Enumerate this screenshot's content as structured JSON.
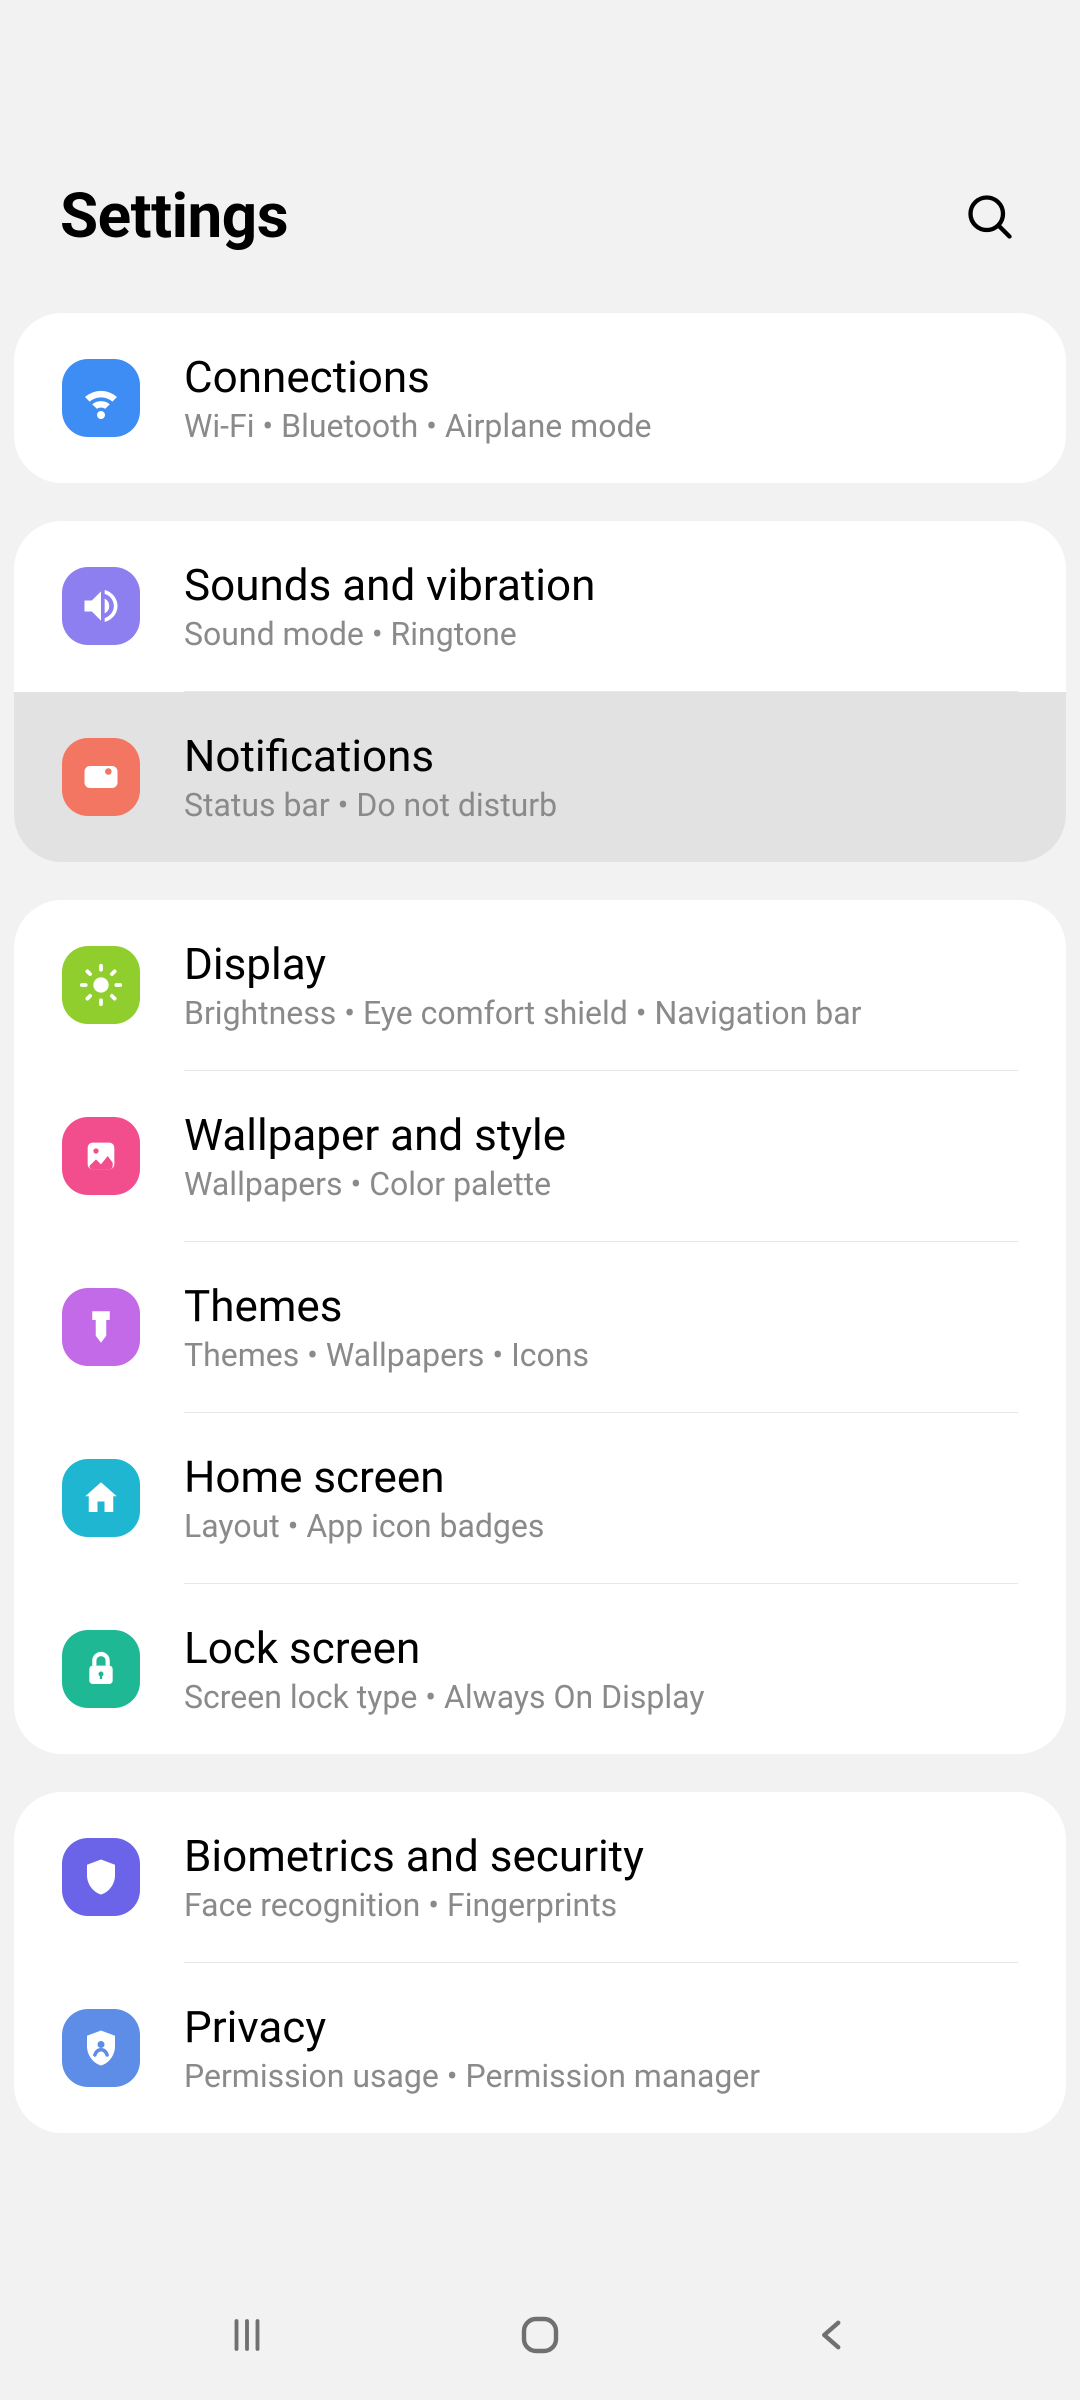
{
  "header": {
    "title": "Settings"
  },
  "groups": [
    {
      "items": [
        {
          "id": "connections",
          "title": "Connections",
          "subtitle": "Wi-Fi  •  Bluetooth  •  Airplane mode",
          "iconColor": "bg-blue-wifi",
          "highlighted": false
        }
      ]
    },
    {
      "items": [
        {
          "id": "sounds",
          "title": "Sounds and vibration",
          "subtitle": "Sound mode  •  Ringtone",
          "iconColor": "bg-purple-sound",
          "highlighted": false
        },
        {
          "id": "notifications",
          "title": "Notifications",
          "subtitle": "Status bar  •  Do not disturb",
          "iconColor": "bg-coral",
          "highlighted": true
        }
      ]
    },
    {
      "items": [
        {
          "id": "display",
          "title": "Display",
          "subtitle": "Brightness  •  Eye comfort shield  •  Navigation bar",
          "iconColor": "bg-green-display",
          "highlighted": false
        },
        {
          "id": "wallpaper",
          "title": "Wallpaper and style",
          "subtitle": "Wallpapers  •  Color palette",
          "iconColor": "bg-pink",
          "highlighted": false
        },
        {
          "id": "themes",
          "title": "Themes",
          "subtitle": "Themes  •  Wallpapers  •  Icons",
          "iconColor": "bg-purple-themes",
          "highlighted": false
        },
        {
          "id": "homescreen",
          "title": "Home screen",
          "subtitle": "Layout  •  App icon badges",
          "iconColor": "bg-cyan",
          "highlighted": false
        },
        {
          "id": "lockscreen",
          "title": "Lock screen",
          "subtitle": "Screen lock type  •  Always On Display",
          "iconColor": "bg-teal",
          "highlighted": false
        }
      ]
    },
    {
      "items": [
        {
          "id": "biometrics",
          "title": "Biometrics and security",
          "subtitle": "Face recognition  •  Fingerprints",
          "iconColor": "bg-indigo",
          "highlighted": false
        },
        {
          "id": "privacy",
          "title": "Privacy",
          "subtitle": "Permission usage  •  Permission manager",
          "iconColor": "bg-blue-privacy",
          "highlighted": false
        }
      ]
    }
  ]
}
